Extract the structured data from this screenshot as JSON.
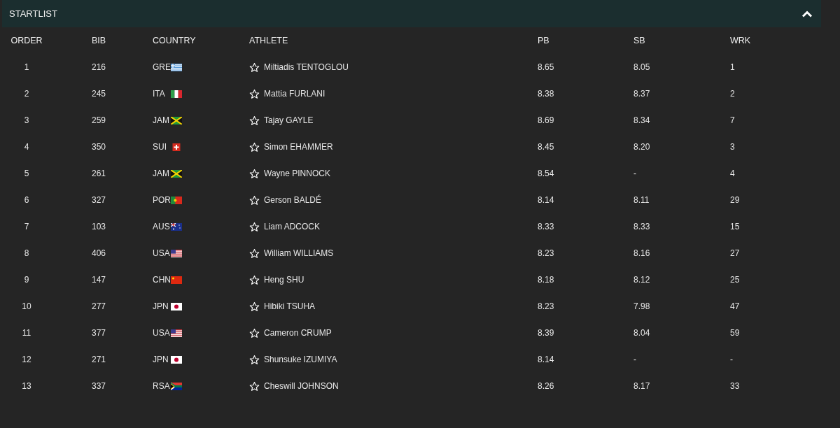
{
  "panel": {
    "title": "STARTLIST",
    "expanded": true
  },
  "columns": [
    "ORDER",
    "BIB",
    "COUNTRY",
    "ATHLETE",
    "PB",
    "SB",
    "WRK"
  ],
  "rows": [
    {
      "order": "1",
      "bib": "216",
      "country": "GRE",
      "kind": "gre",
      "athlete": "Miltiadis TENTOGLOU",
      "pb": "8.65",
      "sb": "8.05",
      "wrk": "1"
    },
    {
      "order": "2",
      "bib": "245",
      "country": "ITA",
      "kind": "ita",
      "athlete": "Mattia FURLANI",
      "pb": "8.38",
      "sb": "8.37",
      "wrk": "2"
    },
    {
      "order": "3",
      "bib": "259",
      "country": "JAM",
      "kind": "jam",
      "athlete": "Tajay GAYLE",
      "pb": "8.69",
      "sb": "8.34",
      "wrk": "7"
    },
    {
      "order": "4",
      "bib": "350",
      "country": "SUI",
      "kind": "sui",
      "athlete": "Simon EHAMMER",
      "pb": "8.45",
      "sb": "8.20",
      "wrk": "3"
    },
    {
      "order": "5",
      "bib": "261",
      "country": "JAM",
      "kind": "jam",
      "athlete": "Wayne PINNOCK",
      "pb": "8.54",
      "sb": "-",
      "wrk": "4"
    },
    {
      "order": "6",
      "bib": "327",
      "country": "POR",
      "kind": "por",
      "athlete": "Gerson BALDÉ",
      "pb": "8.14",
      "sb": "8.11",
      "wrk": "29"
    },
    {
      "order": "7",
      "bib": "103",
      "country": "AUS",
      "kind": "aus",
      "athlete": "Liam ADCOCK",
      "pb": "8.33",
      "sb": "8.33",
      "wrk": "15"
    },
    {
      "order": "8",
      "bib": "406",
      "country": "USA",
      "kind": "usa",
      "athlete": "William WILLIAMS",
      "pb": "8.23",
      "sb": "8.16",
      "wrk": "27"
    },
    {
      "order": "9",
      "bib": "147",
      "country": "CHN",
      "kind": "chn",
      "athlete": "Heng SHU",
      "pb": "8.18",
      "sb": "8.12",
      "wrk": "25"
    },
    {
      "order": "10",
      "bib": "277",
      "country": "JPN",
      "kind": "jpn",
      "athlete": "Hibiki TSUHA",
      "pb": "8.23",
      "sb": "7.98",
      "wrk": "47"
    },
    {
      "order": "11",
      "bib": "377",
      "country": "USA",
      "kind": "usa",
      "athlete": "Cameron CRUMP",
      "pb": "8.39",
      "sb": "8.04",
      "wrk": "59"
    },
    {
      "order": "12",
      "bib": "271",
      "country": "JPN",
      "kind": "jpn",
      "athlete": "Shunsuke IZUMIYA",
      "pb": "8.14",
      "sb": "-",
      "wrk": "-"
    },
    {
      "order": "13",
      "bib": "337",
      "country": "RSA",
      "kind": "rsa",
      "athlete": "Cheswill JOHNSON",
      "pb": "8.26",
      "sb": "8.17",
      "wrk": "33"
    }
  ]
}
